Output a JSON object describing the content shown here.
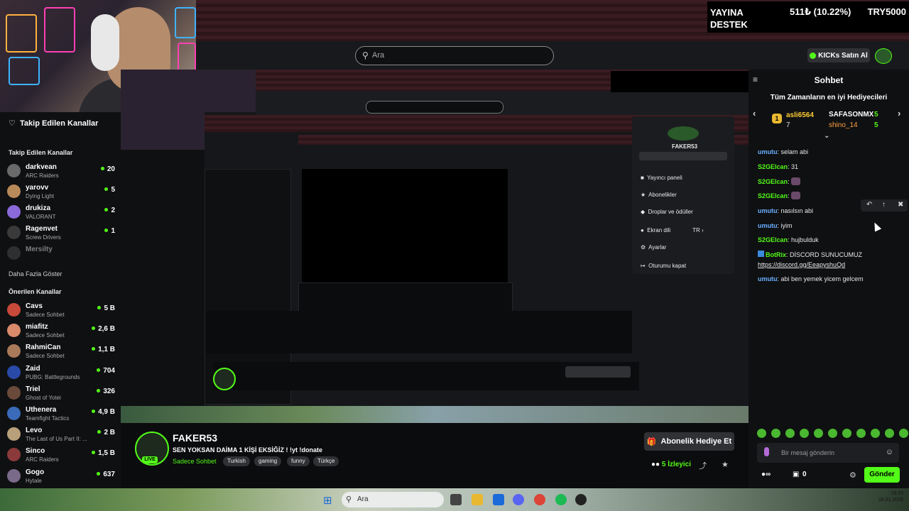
{
  "donation_bar": {
    "label_line1": "YAYINA",
    "label_line2": "DESTEK",
    "amount": "511₺ (10.22%)",
    "goal": "TRY5000"
  },
  "header": {
    "search_placeholder": "Ara",
    "kicks_button": "KICKs Satın Al"
  },
  "sidebar": {
    "title": "Takip Edilen Kanallar",
    "followed_heading": "Takip Edilen Kanallar",
    "followed": [
      {
        "name": "darkvean",
        "game": "ARC Raiders",
        "viewers": "20",
        "color": "#6a6a6a"
      },
      {
        "name": "yarovv",
        "game": "Dying Light",
        "viewers": "5",
        "color": "#b88a5a"
      },
      {
        "name": "drukiza",
        "game": "VALORANT",
        "viewers": "2",
        "color": "#8a6ad9"
      },
      {
        "name": "Ragenvet",
        "game": "Screw Drivers",
        "viewers": "1",
        "color": "#3a3a3a"
      },
      {
        "name": "Mersilty",
        "game": "",
        "viewers": "",
        "color": "#555555"
      }
    ],
    "show_more": "Daha Fazla Göster",
    "recommended_heading": "Önerilen Kanallar",
    "recommended": [
      {
        "name": "Cavs",
        "game": "Sadece Sohbet",
        "viewers": "5 B",
        "color": "#c84a3a"
      },
      {
        "name": "miafitz",
        "game": "Sadece Sohbet",
        "viewers": "2,6 B",
        "color": "#d98a6a"
      },
      {
        "name": "RahmiCan",
        "game": "Sadece Sohbet",
        "viewers": "1,1 B",
        "color": "#a87a5a"
      },
      {
        "name": "Zaid",
        "game": "PUBG: Battlegrounds",
        "viewers": "704",
        "color": "#2a4aa8"
      },
      {
        "name": "Triel",
        "game": "Ghost of Yotei",
        "viewers": "326",
        "color": "#6a4a3a"
      },
      {
        "name": "Uthenera",
        "game": "Teamfight Tactics",
        "viewers": "4,9 B",
        "color": "#3a6ab8"
      },
      {
        "name": "Levo",
        "game": "The Last of Us Part II: ...",
        "viewers": "2 B",
        "color": "#b8a07a"
      },
      {
        "name": "Sinco",
        "game": "ARC Raiders",
        "viewers": "1,5 B",
        "color": "#8a3a3a"
      },
      {
        "name": "Gogo",
        "game": "Hytale",
        "viewers": "637",
        "color": "#7a6a8a"
      }
    ]
  },
  "stream": {
    "streamer": "FAKER53",
    "title": "SEN YOKSAN DAİMA 1 KİŞİ EKSİĞİZ ! !yt !donate",
    "category": "Sadece Sohbet",
    "tags": [
      "Turkish",
      "gaming",
      "funny",
      "Türkçe"
    ],
    "live": "LIVE",
    "gift_button": "Abonelik Hediye Et",
    "viewers_count": "5",
    "viewers_label": "İzleyici"
  },
  "chat": {
    "title": "Sohbet",
    "top_gifters_title": "Tüm Zamanların en iyi Hediyecileri",
    "gifters": [
      {
        "rank": "1",
        "name": "asli6564",
        "count": "7"
      },
      {
        "name": "SAFASONMX",
        "count": "5"
      },
      {
        "name": "shino_14",
        "count": "5"
      }
    ],
    "messages": [
      {
        "user": "umutu",
        "text": "selam abi",
        "user_color": "#6ab0ff"
      },
      {
        "user": "S2GElcan",
        "text": "31",
        "user_color": "#53fc18"
      },
      {
        "user": "S2GElcan",
        "text": "",
        "user_color": "#53fc18"
      },
      {
        "user": "S2GElcan",
        "text": "",
        "user_color": "#53fc18"
      },
      {
        "user": "umutu",
        "text": "nasılsın abi",
        "user_color": "#6ab0ff"
      },
      {
        "user": "umutu",
        "text": "iyim",
        "user_color": "#6ab0ff"
      },
      {
        "user": "S2GElcan",
        "text": "hujbulduk",
        "user_color": "#53fc18"
      },
      {
        "user": "BotRix",
        "text": "DİSCORD SUNUCUMUZ",
        "user_color": "#53fc18"
      },
      {
        "user": "",
        "text": "https://discord.gg/EeapyshuQd",
        "user_color": "#ffffff"
      },
      {
        "user": "umutu",
        "text": "abi ben yemek yicem gelcem",
        "user_color": "#6ab0ff"
      }
    ],
    "input_placeholder": "Bir mesaj gönderin",
    "points": "0",
    "send_button": "Gönder"
  },
  "taskbar": {
    "search_placeholder": "Ara",
    "time": "19:25",
    "date": "16.01.2026"
  },
  "colors": {
    "accent": "#53fc18",
    "background": "#0b0c0e",
    "panel": "#0f1012"
  }
}
